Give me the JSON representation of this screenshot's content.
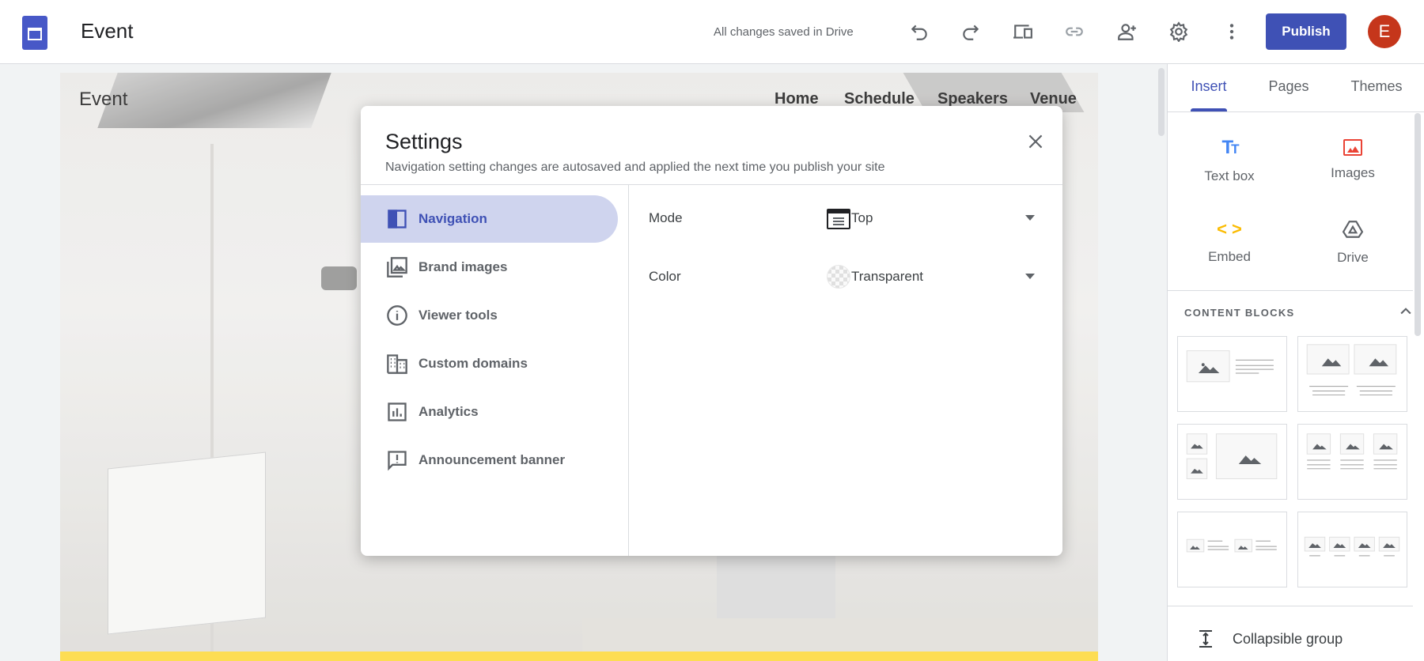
{
  "topbar": {
    "doc_title": "Event",
    "save_status": "All changes saved in Drive",
    "publish_label": "Publish",
    "avatar_initial": "E",
    "icons": [
      "undo-icon",
      "redo-icon",
      "preview-icon",
      "link-icon",
      "share-icon",
      "settings-icon",
      "more-icon"
    ]
  },
  "site": {
    "title": "Event",
    "nav": [
      "Home",
      "Schedule",
      "Speakers",
      "Venue"
    ]
  },
  "dialog": {
    "title": "Settings",
    "subtitle": "Navigation setting changes are autosaved and applied the next time you publish your site",
    "nav": [
      {
        "label": "Navigation",
        "icon": "navigation-icon",
        "active": true
      },
      {
        "label": "Brand images",
        "icon": "brand-images-icon"
      },
      {
        "label": "Viewer tools",
        "icon": "info-icon"
      },
      {
        "label": "Custom domains",
        "icon": "domain-icon"
      },
      {
        "label": "Analytics",
        "icon": "analytics-icon"
      },
      {
        "label": "Announcement banner",
        "icon": "announcement-icon"
      }
    ],
    "settings": [
      {
        "label": "Mode",
        "value": "Top"
      },
      {
        "label": "Color",
        "value": "Transparent"
      }
    ]
  },
  "panel": {
    "tabs": [
      "Insert",
      "Pages",
      "Themes"
    ],
    "active_tab": "Insert",
    "insert": [
      {
        "label": "Text box",
        "color": "#4285f4"
      },
      {
        "label": "Images",
        "color": "#ea4335"
      },
      {
        "label": "Embed",
        "color": "#fbbc04"
      },
      {
        "label": "Drive",
        "color": "#5f6368"
      }
    ],
    "content_blocks_title": "CONTENT BLOCKS",
    "collapsible_label": "Collapsible group"
  },
  "colors": {
    "accent": "#3f51b5",
    "banner": "#fdd835",
    "avatar": "#c5361b"
  }
}
